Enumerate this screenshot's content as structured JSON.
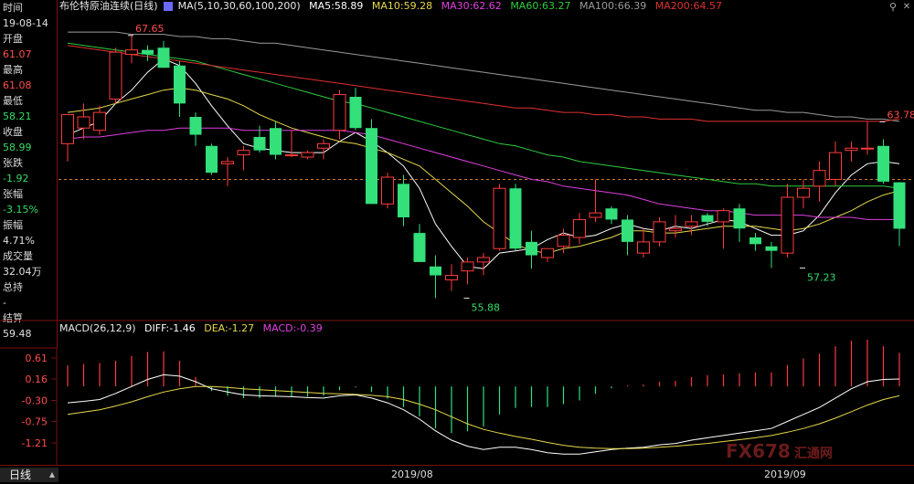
{
  "info": {
    "time_label": "时间",
    "time_value": "19-08-14",
    "open_label": "开盘",
    "open_value": "61.07",
    "high_label": "最高",
    "high_value": "61.08",
    "low_label": "最低",
    "low_value": "58.21",
    "close_label": "收盘",
    "close_value": "58.99",
    "change_label": "张跌",
    "change_value": "-1.92",
    "pct_label": "张幅",
    "pct_value": "-3.15%",
    "amp_label": "振幅",
    "amp_value": "4.71%",
    "vol_label": "成交量",
    "vol_value": "32.04万",
    "oi_label": "总持",
    "oi_value": "-",
    "settle_label": "结算",
    "settle_value": "59.48"
  },
  "title": {
    "name": "布伦特原油连续(日线)",
    "ma_params": "MA(5,10,30,60,100,200)",
    "ma5": "MA5:58.89",
    "ma10": "MA10:59.28",
    "ma30": "MA30:62.62",
    "ma60": "MA60:63.27",
    "ma100": "MA100:66.39",
    "ma200": "MA200:64.57"
  },
  "macd_header": {
    "params": "MACD(26,12,9)",
    "diff": "DIFF:-1.46",
    "dea": "DEA:-1.27",
    "macd": "MACD:-0.39"
  },
  "bottom": {
    "period_tab": "日线",
    "date1": "2019/08",
    "date2": "2019/09"
  },
  "icons": {
    "search": "search-icon",
    "close": "close-icon"
  },
  "watermark": {
    "fx": "FX678",
    "cn": "汇通网"
  },
  "colors": {
    "up": "#ff3b3b",
    "down": "#33e07a",
    "ma5": "#ffffff",
    "ma10": "#e6d84a",
    "ma30": "#e040e0",
    "ma60": "#2fcc3f",
    "ma100": "#9a9a9a",
    "ma200": "#e03030",
    "diff": "#ffffff",
    "dea": "#e6d84a",
    "macd_up": "#ff3b3b",
    "macd_down": "#33e07a"
  },
  "chart_data": {
    "type": "candlestick",
    "price_range": [
      55.0,
      68.5
    ],
    "annotations": [
      {
        "text": "67.65",
        "index": 4,
        "value": 67.65
      },
      {
        "text": "55.88",
        "index": 25,
        "value": 55.88
      },
      {
        "text": "57.23",
        "index": 46,
        "value": 57.23
      },
      {
        "text": "63.78",
        "index": 51,
        "value": 63.78
      }
    ],
    "reference_line": 61.2,
    "candles": [
      {
        "o": 62.8,
        "h": 64.1,
        "l": 62.0,
        "c": 64.1
      },
      {
        "o": 63.5,
        "h": 64.6,
        "l": 63.0,
        "c": 64.0
      },
      {
        "o": 63.4,
        "h": 64.5,
        "l": 63.2,
        "c": 64.2
      },
      {
        "o": 64.8,
        "h": 67.1,
        "l": 64.6,
        "c": 66.9
      },
      {
        "o": 66.8,
        "h": 67.65,
        "l": 66.4,
        "c": 67.0
      },
      {
        "o": 67.0,
        "h": 67.2,
        "l": 66.5,
        "c": 66.8
      },
      {
        "o": 67.1,
        "h": 67.4,
        "l": 66.2,
        "c": 66.2
      },
      {
        "o": 66.3,
        "h": 66.5,
        "l": 64.0,
        "c": 64.6
      },
      {
        "o": 64.0,
        "h": 64.2,
        "l": 62.7,
        "c": 63.2
      },
      {
        "o": 62.7,
        "h": 62.8,
        "l": 61.4,
        "c": 61.5
      },
      {
        "o": 61.9,
        "h": 62.2,
        "l": 60.9,
        "c": 62.0
      },
      {
        "o": 62.3,
        "h": 62.7,
        "l": 61.6,
        "c": 62.5
      },
      {
        "o": 63.1,
        "h": 63.6,
        "l": 62.4,
        "c": 62.5
      },
      {
        "o": 63.5,
        "h": 63.8,
        "l": 62.1,
        "c": 62.3
      },
      {
        "o": 62.3,
        "h": 63.4,
        "l": 62.2,
        "c": 62.3
      },
      {
        "o": 62.2,
        "h": 62.5,
        "l": 62.1,
        "c": 62.4
      },
      {
        "o": 62.6,
        "h": 63.0,
        "l": 62.1,
        "c": 62.8
      },
      {
        "o": 63.4,
        "h": 65.2,
        "l": 63.0,
        "c": 65.0
      },
      {
        "o": 64.9,
        "h": 65.3,
        "l": 63.4,
        "c": 63.5
      },
      {
        "o": 63.5,
        "h": 63.9,
        "l": 60.1,
        "c": 60.1
      },
      {
        "o": 60.1,
        "h": 61.5,
        "l": 59.9,
        "c": 61.3
      },
      {
        "o": 61.0,
        "h": 61.4,
        "l": 59.1,
        "c": 59.5
      },
      {
        "o": 58.8,
        "h": 59.2,
        "l": 57.5,
        "c": 57.5
      },
      {
        "o": 57.3,
        "h": 57.8,
        "l": 55.88,
        "c": 56.9
      },
      {
        "o": 56.7,
        "h": 57.4,
        "l": 56.2,
        "c": 56.9
      },
      {
        "o": 57.1,
        "h": 57.7,
        "l": 56.5,
        "c": 57.5
      },
      {
        "o": 57.5,
        "h": 57.9,
        "l": 56.9,
        "c": 57.7
      },
      {
        "o": 58.1,
        "h": 61.0,
        "l": 58.0,
        "c": 60.8
      },
      {
        "o": 60.8,
        "h": 61.0,
        "l": 58.0,
        "c": 58.1
      },
      {
        "o": 58.4,
        "h": 58.9,
        "l": 57.2,
        "c": 57.8
      },
      {
        "o": 57.7,
        "h": 58.1,
        "l": 57.5,
        "c": 58.1
      },
      {
        "o": 58.2,
        "h": 59.0,
        "l": 57.9,
        "c": 58.7
      },
      {
        "o": 58.6,
        "h": 59.7,
        "l": 58.3,
        "c": 59.4
      },
      {
        "o": 59.5,
        "h": 61.2,
        "l": 59.3,
        "c": 59.7
      },
      {
        "o": 59.9,
        "h": 60.0,
        "l": 59.2,
        "c": 59.4
      },
      {
        "o": 59.4,
        "h": 59.6,
        "l": 57.8,
        "c": 58.4
      },
      {
        "o": 57.9,
        "h": 59.0,
        "l": 57.7,
        "c": 58.4
      },
      {
        "o": 58.4,
        "h": 59.5,
        "l": 58.2,
        "c": 59.3
      },
      {
        "o": 58.9,
        "h": 59.6,
        "l": 58.6,
        "c": 59.0
      },
      {
        "o": 59.1,
        "h": 59.6,
        "l": 58.7,
        "c": 59.3
      },
      {
        "o": 59.6,
        "h": 59.7,
        "l": 59.1,
        "c": 59.3
      },
      {
        "o": 59.3,
        "h": 59.9,
        "l": 58.1,
        "c": 59.8
      },
      {
        "o": 59.9,
        "h": 60.1,
        "l": 58.4,
        "c": 59.0
      },
      {
        "o": 58.6,
        "h": 58.8,
        "l": 58.0,
        "c": 58.3
      },
      {
        "o": 58.2,
        "h": 58.4,
        "l": 57.23,
        "c": 58.0
      },
      {
        "o": 57.9,
        "h": 61.0,
        "l": 57.7,
        "c": 60.4
      },
      {
        "o": 60.4,
        "h": 61.2,
        "l": 59.9,
        "c": 60.8
      },
      {
        "o": 60.9,
        "h": 62.0,
        "l": 60.2,
        "c": 61.6
      },
      {
        "o": 61.2,
        "h": 62.9,
        "l": 60.9,
        "c": 62.4
      },
      {
        "o": 62.5,
        "h": 62.9,
        "l": 62.0,
        "c": 62.6
      },
      {
        "o": 62.6,
        "h": 63.78,
        "l": 62.3,
        "c": 62.6
      },
      {
        "o": 62.7,
        "h": 63.0,
        "l": 61.0,
        "c": 61.1
      },
      {
        "o": 61.07,
        "h": 61.08,
        "l": 58.21,
        "c": 58.99
      }
    ],
    "ma_series": [
      {
        "name": "MA5",
        "values": [
          63.2,
          63.5,
          63.8,
          64.6,
          65.2,
          66.0,
          66.6,
          66.3,
          65.5,
          64.5,
          63.6,
          62.8,
          62.6,
          62.5,
          62.4,
          62.4,
          62.4,
          62.9,
          63.3,
          62.9,
          62.4,
          61.8,
          60.8,
          59.2,
          58.2,
          57.3,
          57.2,
          57.9,
          58.0,
          58.1,
          58.5,
          58.8,
          58.6,
          58.7,
          59.0,
          59.2,
          59.0,
          58.9,
          59.1,
          59.0,
          59.2,
          59.4,
          59.3,
          59.0,
          58.7,
          58.7,
          58.9,
          59.6,
          60.6,
          61.4,
          61.9,
          62.0,
          61.9
        ]
      },
      {
        "name": "MA10",
        "values": [
          64.2,
          64.3,
          64.4,
          64.6,
          64.8,
          65.0,
          65.2,
          65.3,
          65.2,
          65.0,
          64.8,
          64.5,
          64.1,
          63.8,
          63.5,
          63.3,
          63.1,
          62.9,
          62.8,
          62.6,
          62.4,
          62.1,
          61.8,
          61.2,
          60.6,
          60.0,
          59.3,
          58.8,
          58.3,
          58.0,
          57.9,
          58.1,
          58.2,
          58.4,
          58.6,
          58.9,
          58.9,
          58.8,
          58.8,
          58.9,
          59.0,
          59.1,
          59.1,
          59.1,
          59.0,
          58.9,
          59.0,
          59.2,
          59.5,
          59.8,
          60.2,
          60.5,
          60.7
        ]
      },
      {
        "name": "MA30",
        "values": [
          63.0,
          63.1,
          63.1,
          63.2,
          63.3,
          63.4,
          63.4,
          63.5,
          63.5,
          63.5,
          63.5,
          63.4,
          63.4,
          63.4,
          63.4,
          63.4,
          63.4,
          63.4,
          63.3,
          63.2,
          63.0,
          62.8,
          62.6,
          62.4,
          62.2,
          62.0,
          61.8,
          61.6,
          61.4,
          61.2,
          61.1,
          60.9,
          60.8,
          60.7,
          60.6,
          60.5,
          60.3,
          60.1,
          60.0,
          59.9,
          59.8,
          59.8,
          59.7,
          59.6,
          59.6,
          59.6,
          59.6,
          59.5,
          59.5,
          59.5,
          59.4,
          59.4,
          59.4
        ]
      },
      {
        "name": "MA60",
        "values": [
          67.3,
          67.2,
          67.1,
          67.0,
          66.9,
          66.8,
          66.7,
          66.6,
          66.5,
          66.3,
          66.1,
          65.9,
          65.7,
          65.5,
          65.3,
          65.1,
          64.9,
          64.7,
          64.6,
          64.4,
          64.2,
          64.0,
          63.8,
          63.6,
          63.4,
          63.2,
          63.0,
          62.8,
          62.7,
          62.5,
          62.3,
          62.2,
          62.0,
          61.9,
          61.8,
          61.7,
          61.6,
          61.5,
          61.4,
          61.3,
          61.2,
          61.1,
          61.0,
          61.0,
          60.9,
          60.9,
          60.9,
          60.9,
          60.9,
          60.9,
          60.9,
          60.9,
          60.8
        ]
      },
      {
        "name": "MA100",
        "values": [
          67.8,
          67.8,
          67.8,
          67.8,
          67.7,
          67.7,
          67.7,
          67.6,
          67.6,
          67.5,
          67.5,
          67.4,
          67.3,
          67.3,
          67.2,
          67.1,
          67.0,
          66.9,
          66.8,
          66.7,
          66.6,
          66.5,
          66.4,
          66.3,
          66.2,
          66.1,
          66.0,
          65.9,
          65.8,
          65.7,
          65.6,
          65.5,
          65.4,
          65.3,
          65.2,
          65.1,
          65.0,
          64.9,
          64.8,
          64.7,
          64.6,
          64.5,
          64.4,
          64.3,
          64.3,
          64.2,
          64.2,
          64.1,
          64.0,
          64.0,
          63.9,
          63.9,
          63.8
        ]
      },
      {
        "name": "MA200",
        "values": [
          67.2,
          67.1,
          67.0,
          66.9,
          66.8,
          66.7,
          66.6,
          66.5,
          66.4,
          66.3,
          66.2,
          66.1,
          66.0,
          65.9,
          65.8,
          65.7,
          65.6,
          65.5,
          65.4,
          65.3,
          65.2,
          65.1,
          65.0,
          64.9,
          64.8,
          64.7,
          64.6,
          64.5,
          64.4,
          64.4,
          64.3,
          64.2,
          64.2,
          64.1,
          64.1,
          64.0,
          64.0,
          63.9,
          63.9,
          63.9,
          63.8,
          63.8,
          63.8,
          63.8,
          63.8,
          63.8,
          63.8,
          63.8,
          63.8,
          63.8,
          63.8,
          63.8,
          63.9
        ]
      }
    ],
    "macd": {
      "range": [
        -1.6,
        1.0
      ],
      "y_ticks": [
        "0.61",
        "0.16",
        "-0.30",
        "-0.75",
        "-1.21"
      ],
      "y_tick_values": [
        0.61,
        0.16,
        -0.3,
        -0.75,
        -1.21
      ],
      "diff": [
        -0.35,
        -0.32,
        -0.28,
        -0.15,
        0.0,
        0.15,
        0.25,
        0.22,
        0.1,
        -0.05,
        -0.12,
        -0.18,
        -0.2,
        -0.21,
        -0.22,
        -0.24,
        -0.25,
        -0.2,
        -0.18,
        -0.25,
        -0.35,
        -0.5,
        -0.7,
        -0.95,
        -1.15,
        -1.28,
        -1.35,
        -1.3,
        -1.3,
        -1.35,
        -1.42,
        -1.45,
        -1.45,
        -1.4,
        -1.35,
        -1.32,
        -1.3,
        -1.25,
        -1.22,
        -1.15,
        -1.1,
        -1.05,
        -1.0,
        -0.95,
        -0.9,
        -0.75,
        -0.6,
        -0.45,
        -0.25,
        -0.05,
        0.1,
        0.15,
        0.16
      ],
      "dea": [
        -0.6,
        -0.55,
        -0.5,
        -0.42,
        -0.33,
        -0.22,
        -0.12,
        -0.05,
        0.0,
        0.0,
        -0.02,
        -0.05,
        -0.07,
        -0.09,
        -0.11,
        -0.13,
        -0.15,
        -0.16,
        -0.17,
        -0.19,
        -0.22,
        -0.28,
        -0.38,
        -0.5,
        -0.65,
        -0.8,
        -0.92,
        -1.0,
        -1.07,
        -1.13,
        -1.2,
        -1.26,
        -1.3,
        -1.32,
        -1.33,
        -1.33,
        -1.32,
        -1.3,
        -1.28,
        -1.25,
        -1.22,
        -1.18,
        -1.14,
        -1.1,
        -1.05,
        -0.98,
        -0.9,
        -0.8,
        -0.68,
        -0.54,
        -0.4,
        -0.28,
        -0.2
      ],
      "hist": [
        0.45,
        0.48,
        0.5,
        0.55,
        0.65,
        0.74,
        0.75,
        0.55,
        0.2,
        -0.1,
        -0.2,
        -0.25,
        -0.25,
        -0.22,
        -0.22,
        -0.22,
        -0.2,
        -0.08,
        -0.02,
        -0.12,
        -0.26,
        -0.44,
        -0.64,
        -0.9,
        -1.0,
        -0.96,
        -0.86,
        -0.6,
        -0.46,
        -0.44,
        -0.44,
        -0.38,
        -0.3,
        -0.16,
        -0.04,
        0.02,
        0.04,
        0.1,
        0.12,
        0.2,
        0.24,
        0.26,
        0.28,
        0.3,
        0.3,
        0.46,
        0.6,
        0.7,
        0.86,
        0.98,
        1.0,
        0.86,
        0.72
      ]
    }
  }
}
